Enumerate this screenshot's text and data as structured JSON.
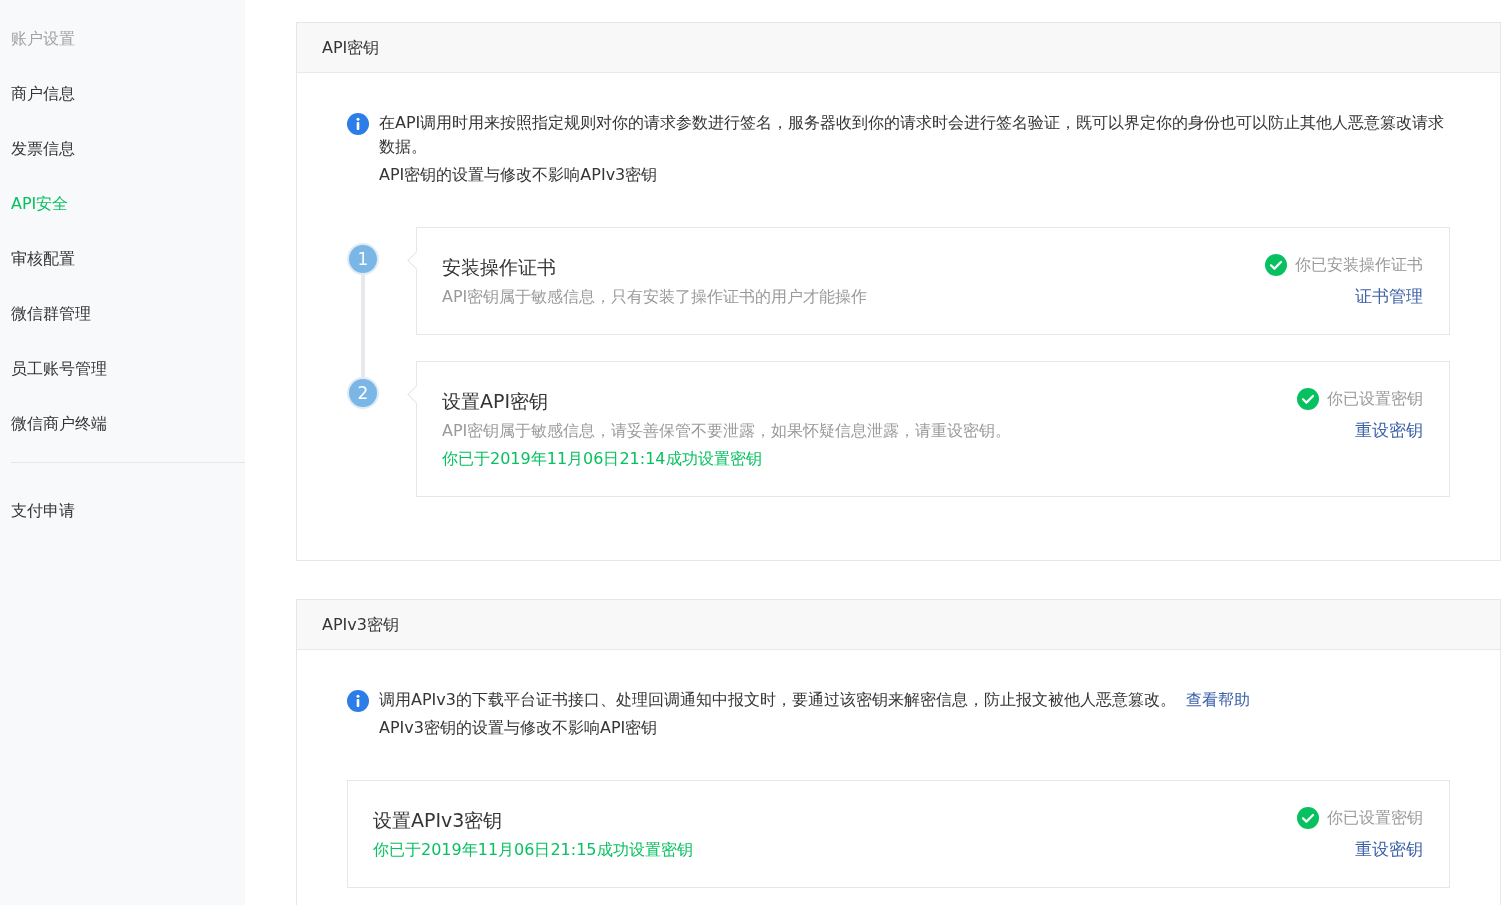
{
  "sidebar": {
    "heading": "账户设置",
    "items": [
      {
        "label": "商户信息",
        "selected": false
      },
      {
        "label": "发票信息",
        "selected": false
      },
      {
        "label": "API安全",
        "selected": true
      },
      {
        "label": "审核配置",
        "selected": false
      },
      {
        "label": "微信群管理",
        "selected": false
      },
      {
        "label": "员工账号管理",
        "selected": false
      },
      {
        "label": "微信商户终端",
        "selected": false
      }
    ],
    "footer_items": [
      {
        "label": "支付申请",
        "selected": false
      }
    ]
  },
  "sections": [
    {
      "title": "API密钥",
      "notice": {
        "lines": [
          "在API调用时用来按照指定规则对你的请求参数进行签名，服务器收到你的请求时会进行签名验证，既可以界定你的身份也可以防止其他人恶意篡改请求数据。",
          "API密钥的设置与修改不影响APIv3密钥"
        ]
      },
      "steps": [
        {
          "number": "1",
          "title": "安装操作证书",
          "description": "API密钥属于敏感信息，只有安装了操作证书的用户才能操作",
          "status": "你已安装操作证书",
          "action": "证书管理"
        },
        {
          "number": "2",
          "title": "设置API密钥",
          "description": "API密钥属于敏感信息，请妥善保管不要泄露，如果怀疑信息泄露，请重设密钥。",
          "success_text": "你已于2019年11月06日21:14成功设置密钥",
          "status": "你已设置密钥",
          "action": "重设密钥"
        }
      ]
    },
    {
      "title": "APIv3密钥",
      "notice": {
        "lines": [
          "调用APIv3的下载平台证书接口、处理回调通知中报文时，要通过该密钥来解密信息，防止报文被他人恶意篡改。",
          "APIv3密钥的设置与修改不影响API密钥"
        ],
        "link": "查看帮助"
      },
      "steps": [
        {
          "title": "设置APIv3密钥",
          "success_text": "你已于2019年11月06日21:15成功设置密钥",
          "status": "你已设置密钥",
          "action": "重设密钥"
        }
      ]
    }
  ]
}
